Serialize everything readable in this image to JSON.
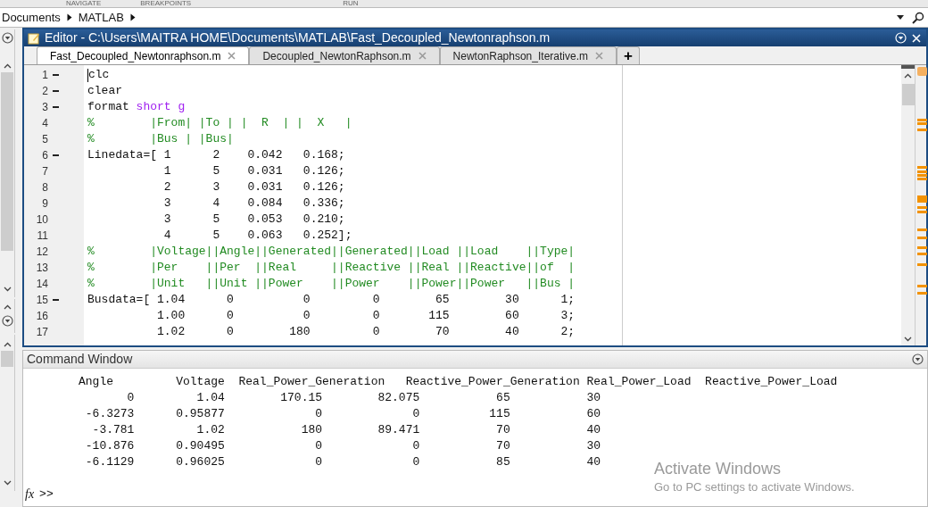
{
  "toolstrip": {
    "sections": [
      "NAVIGATE",
      "BREAKPOINTS",
      "RUN"
    ]
  },
  "address_bar": {
    "path": [
      "Documents",
      "MATLAB"
    ]
  },
  "editor": {
    "title": "Editor - C:\\Users\\MAITRA HOME\\Documents\\MATLAB\\Fast_Decoupled_Newtonraphson.m",
    "tabs": [
      {
        "label": "Fast_Decoupled_Newtonraphson.m",
        "selected": true
      },
      {
        "label": "Decoupled_NewtonRaphson.m",
        "selected": false
      },
      {
        "label": "NewtonRaphson_Iterative.m",
        "selected": false
      }
    ],
    "new_tab": "+",
    "lines": [
      {
        "number": "1",
        "executable": true,
        "cursor": true,
        "segments": [
          {
            "kind": "code",
            "text": "clc"
          }
        ]
      },
      {
        "number": "2",
        "executable": true,
        "cursor": false,
        "segments": [
          {
            "kind": "code",
            "text": "clear"
          }
        ]
      },
      {
        "number": "3",
        "executable": true,
        "cursor": false,
        "segments": [
          {
            "kind": "code",
            "text": "format "
          },
          {
            "kind": "string",
            "text": "short g"
          }
        ]
      },
      {
        "number": "4",
        "executable": false,
        "cursor": false,
        "segments": [
          {
            "kind": "comment",
            "text": "%        |From| |To | |  R  | |  X   |"
          }
        ]
      },
      {
        "number": "5",
        "executable": false,
        "cursor": false,
        "segments": [
          {
            "kind": "comment",
            "text": "%        |Bus | |Bus|"
          }
        ]
      },
      {
        "number": "6",
        "executable": true,
        "cursor": false,
        "segments": [
          {
            "kind": "code",
            "text": "Linedata=[ 1      2    0.042   0.168;"
          }
        ]
      },
      {
        "number": "7",
        "executable": false,
        "cursor": false,
        "segments": [
          {
            "kind": "code",
            "text": "           1      5    0.031   0.126;"
          }
        ]
      },
      {
        "number": "8",
        "executable": false,
        "cursor": false,
        "segments": [
          {
            "kind": "code",
            "text": "           2      3    0.031   0.126;"
          }
        ]
      },
      {
        "number": "9",
        "executable": false,
        "cursor": false,
        "segments": [
          {
            "kind": "code",
            "text": "           3      4    0.084   0.336;"
          }
        ]
      },
      {
        "number": "10",
        "executable": false,
        "cursor": false,
        "segments": [
          {
            "kind": "code",
            "text": "           3      5    0.053   0.210;"
          }
        ]
      },
      {
        "number": "11",
        "executable": false,
        "cursor": false,
        "segments": [
          {
            "kind": "code",
            "text": "           4      5    0.063   0.252];"
          }
        ]
      },
      {
        "number": "12",
        "executable": false,
        "cursor": false,
        "segments": [
          {
            "kind": "comment",
            "text": "%        |Voltage||Angle||Generated||Generated||Load ||Load    ||Type|"
          }
        ]
      },
      {
        "number": "13",
        "executable": false,
        "cursor": false,
        "segments": [
          {
            "kind": "comment",
            "text": "%        |Per    ||Per  ||Real     ||Reactive ||Real ||Reactive||of  |"
          }
        ]
      },
      {
        "number": "14",
        "executable": false,
        "cursor": false,
        "segments": [
          {
            "kind": "comment",
            "text": "%        |Unit   ||Unit ||Power    ||Power    ||Power||Power   ||Bus |"
          }
        ]
      },
      {
        "number": "15",
        "executable": true,
        "cursor": false,
        "segments": [
          {
            "kind": "code",
            "text": "Busdata=[ 1.04      0          0         0        65        30      1;"
          }
        ]
      },
      {
        "number": "16",
        "executable": false,
        "cursor": false,
        "segments": [
          {
            "kind": "code",
            "text": "          1.00      0          0         0       115        60      3;"
          }
        ]
      },
      {
        "number": "17",
        "executable": false,
        "cursor": false,
        "segments": [
          {
            "kind": "code",
            "text": "          1.02      0        180         0        70        40      2;"
          }
        ]
      }
    ]
  },
  "command_window": {
    "title": "Command Window",
    "output_lines": [
      "Angle         Voltage  Real_Power_Generation   Reactive_Power_Generation Real_Power_Load  Reactive_Power_Load",
      "       0         1.04        170.15        82.075           65           30",
      " -6.3273      0.95877             0             0          115           60",
      "  -3.781         1.02           180        89.471           70           40",
      " -10.876      0.90495             0             0           70           30",
      " -6.1129      0.96025             0             0           85           40"
    ],
    "prompt_icon": "fx",
    "prompt": ">>"
  },
  "activation_notice": {
    "title": "Activate Windows",
    "message": "Go to PC settings to activate Windows."
  }
}
